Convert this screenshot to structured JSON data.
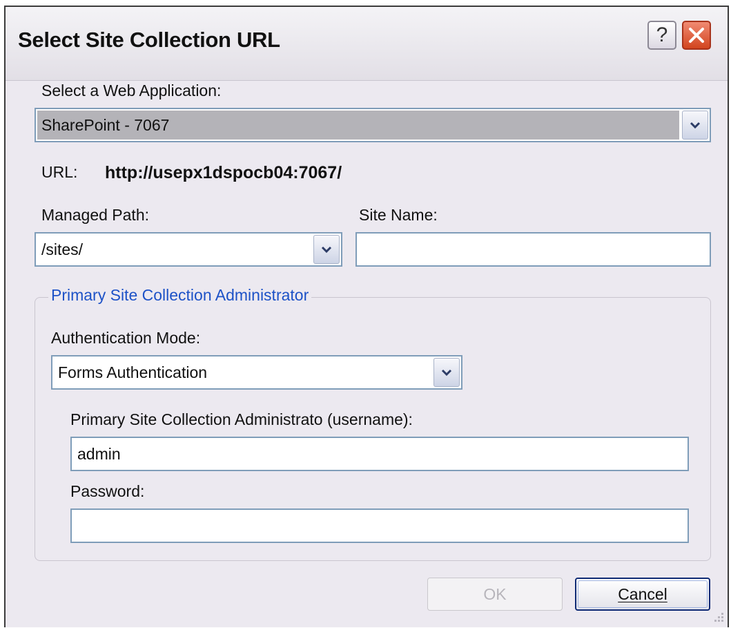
{
  "window": {
    "title": "Select Site Collection URL",
    "help_label": "?"
  },
  "web_app": {
    "label": "Select a Web Application:",
    "selected": "SharePoint - 7067"
  },
  "url": {
    "label": "URL:",
    "value": "http://usepx1dspocb04:7067/"
  },
  "managed_path": {
    "label": "Managed Path:",
    "selected": "/sites/"
  },
  "site_name": {
    "label": "Site Name:",
    "value": ""
  },
  "admin_group": {
    "legend": "Primary Site Collection Administrator",
    "auth_mode_label": "Authentication Mode:",
    "auth_mode_selected": "Forms Authentication",
    "username_label": "Primary Site Collection Administrato (username):",
    "username_value": "admin",
    "password_label": "Password:",
    "password_value": ""
  },
  "buttons": {
    "ok": "OK",
    "cancel": "Cancel"
  },
  "colors": {
    "dialog_bg": "#ece9f0",
    "legend_blue": "#1d52c7",
    "field_border": "#7f9db9",
    "close_red": "#d2451f"
  },
  "icons": {
    "help": "help-icon",
    "close": "close-icon",
    "dropdown": "chevron-down-icon",
    "resize": "resize-grip-icon"
  }
}
